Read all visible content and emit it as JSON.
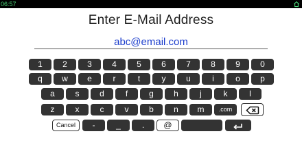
{
  "status_bar": {
    "time": "06:57",
    "icon": "home-icon"
  },
  "title": "Enter E-Mail Address",
  "email": {
    "value": "abc@email.com"
  },
  "keyboard": {
    "row1": [
      "1",
      "2",
      "3",
      "4",
      "5",
      "6",
      "7",
      "8",
      "9",
      "0"
    ],
    "row2": [
      "q",
      "w",
      "e",
      "r",
      "t",
      "y",
      "u",
      "i",
      "o",
      "p"
    ],
    "row3": [
      "a",
      "s",
      "d",
      "f",
      "g",
      "h",
      "j",
      "k",
      "l"
    ],
    "row4": [
      "z",
      "x",
      "c",
      "v",
      "b",
      "n",
      "m"
    ],
    "dotcom": ".com",
    "backspace_icon": "backspace-icon",
    "cancel": "Cancel",
    "dash": "-",
    "underscore": "_",
    "dot": ".",
    "at": "@",
    "enter_icon": "enter-icon"
  },
  "colors": {
    "key": "#333333",
    "email_text": "#1a3ccc",
    "status_text": "#4cd97a"
  }
}
